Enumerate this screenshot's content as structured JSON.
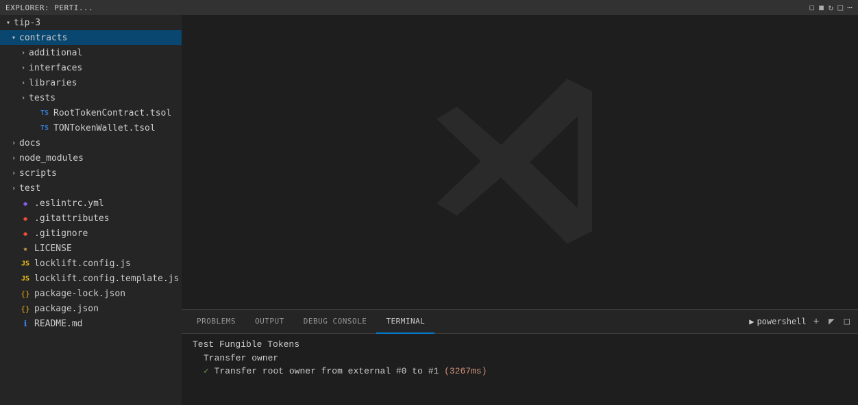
{
  "topbar": {
    "title": "EXPLORER: PERTI...",
    "icons": [
      "new-file",
      "new-folder",
      "refresh",
      "collapse",
      "more"
    ]
  },
  "sidebar": {
    "root": "tip-3",
    "items": [
      {
        "id": "tip3",
        "label": "tip-3",
        "type": "folder",
        "indent": 0,
        "expanded": true,
        "arrow": "▾"
      },
      {
        "id": "contracts",
        "label": "contracts",
        "type": "folder",
        "indent": 1,
        "expanded": true,
        "arrow": "▾",
        "active": true
      },
      {
        "id": "additional",
        "label": "additional",
        "type": "folder",
        "indent": 2,
        "expanded": false,
        "arrow": "›"
      },
      {
        "id": "interfaces",
        "label": "interfaces",
        "type": "folder",
        "indent": 2,
        "expanded": false,
        "arrow": "›"
      },
      {
        "id": "libraries",
        "label": "libraries",
        "type": "folder",
        "indent": 2,
        "expanded": false,
        "arrow": "›"
      },
      {
        "id": "tests",
        "label": "tests",
        "type": "folder",
        "indent": 2,
        "expanded": false,
        "arrow": "›"
      },
      {
        "id": "roottoken",
        "label": "RootTokenContract.tsol",
        "type": "tsol",
        "indent": 3
      },
      {
        "id": "tontoken",
        "label": "TONTokenWallet.tsol",
        "type": "tsol",
        "indent": 3
      },
      {
        "id": "docs",
        "label": "docs",
        "type": "folder",
        "indent": 1,
        "expanded": false,
        "arrow": "›"
      },
      {
        "id": "node_modules",
        "label": "node_modules",
        "type": "folder",
        "indent": 1,
        "expanded": false,
        "arrow": "›"
      },
      {
        "id": "scripts",
        "label": "scripts",
        "type": "folder",
        "indent": 1,
        "expanded": false,
        "arrow": "›"
      },
      {
        "id": "test",
        "label": "test",
        "type": "folder",
        "indent": 1,
        "expanded": false,
        "arrow": "›"
      },
      {
        "id": "eslintrc",
        "label": ".eslintrc.yml",
        "type": "yml",
        "indent": 1
      },
      {
        "id": "gitattributes",
        "label": ".gitattributes",
        "type": "git",
        "indent": 1
      },
      {
        "id": "gitignore",
        "label": ".gitignore",
        "type": "git",
        "indent": 1
      },
      {
        "id": "license",
        "label": "LICENSE",
        "type": "license",
        "indent": 1
      },
      {
        "id": "locklift_config",
        "label": "locklift.config.js",
        "type": "js",
        "indent": 1
      },
      {
        "id": "locklift_template",
        "label": "locklift.config.template.js",
        "type": "js",
        "indent": 1
      },
      {
        "id": "packagelock",
        "label": "package-lock.json",
        "type": "json",
        "indent": 1
      },
      {
        "id": "package",
        "label": "package.json",
        "type": "json",
        "indent": 1
      },
      {
        "id": "readme",
        "label": "README.md",
        "type": "md",
        "indent": 1
      }
    ]
  },
  "panel": {
    "tabs": [
      "PROBLEMS",
      "OUTPUT",
      "DEBUG CONSOLE",
      "TERMINAL"
    ],
    "active_tab": "TERMINAL",
    "terminal_label": "powershell",
    "terminal_lines": [
      {
        "type": "heading",
        "text": "Test Fungible Tokens"
      },
      {
        "type": "subheading",
        "text": "Transfer owner"
      },
      {
        "type": "success",
        "text": "✓ Transfer root owner from external #0 to #1 (3267ms)"
      }
    ]
  }
}
